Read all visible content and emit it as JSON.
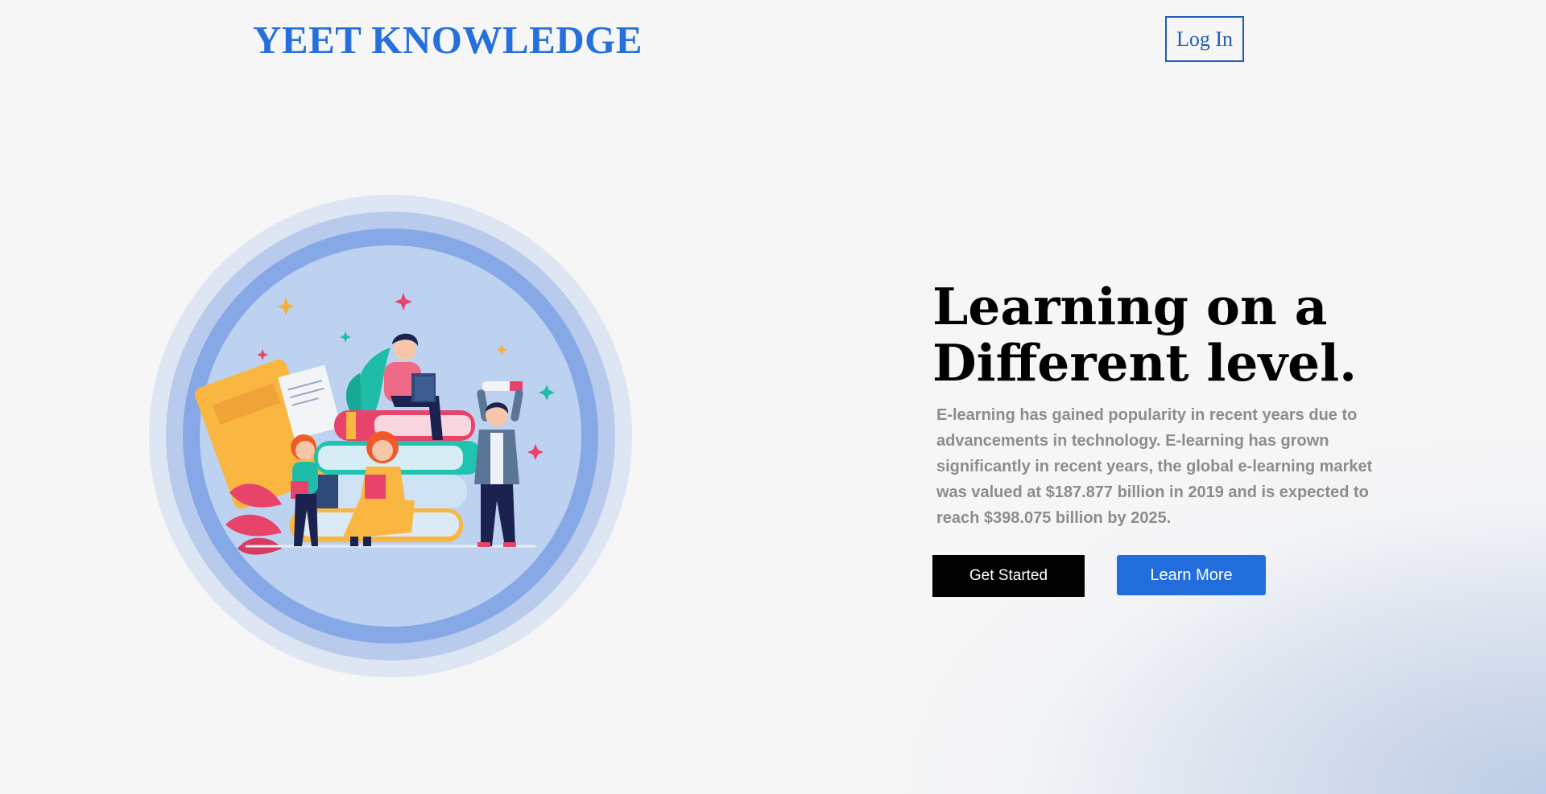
{
  "header": {
    "logo": "YEET KNOWLEDGE",
    "login_label": "Log In"
  },
  "hero": {
    "headline_line1": "Learning on a",
    "headline_line2": "Different level.",
    "description": "E-learning has gained popularity in recent years due to advancements in technology. E-learning has grown significantly in recent years, the global e-learning market was valued at $187.877 billion in 2019 and is expected to reach $398.075 billion by 2025.",
    "primary_button": "Get Started",
    "secondary_button": "Learn More",
    "illustration_icon": "people-reading-books-illustration"
  },
  "colors": {
    "brand_blue": "#2570dc",
    "button_blue": "#226ddc",
    "primary_button_bg": "#000000",
    "background": "#f6f6f6"
  }
}
